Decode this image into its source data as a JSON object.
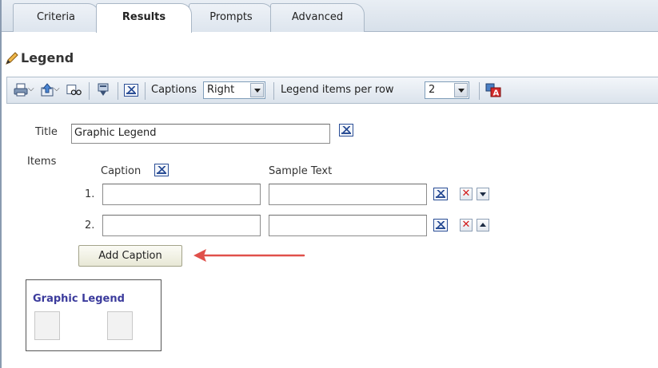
{
  "tabs": [
    {
      "label": "Criteria",
      "active": false
    },
    {
      "label": "Results",
      "active": true
    },
    {
      "label": "Prompts",
      "active": false
    },
    {
      "label": "Advanced",
      "active": false
    }
  ],
  "section": {
    "title": "Legend"
  },
  "toolbar": {
    "captions_label": "Captions",
    "captions_value": "Right",
    "items_per_row_label": "Legend items per row",
    "items_per_row_value": "2"
  },
  "form": {
    "title_label": "Title",
    "title_value": "Graphic Legend",
    "items_label": "Items",
    "caption_header": "Caption",
    "sample_text_header": "Sample Text",
    "rows": [
      {
        "num": "1.",
        "caption": "",
        "sample_text": ""
      },
      {
        "num": "2.",
        "caption": "",
        "sample_text": ""
      }
    ],
    "add_caption_label": "Add Caption"
  },
  "preview": {
    "title": "Graphic Legend"
  },
  "colors": {
    "annotation_arrow": "#e0504a",
    "preview_title": "#3b3b9c"
  }
}
